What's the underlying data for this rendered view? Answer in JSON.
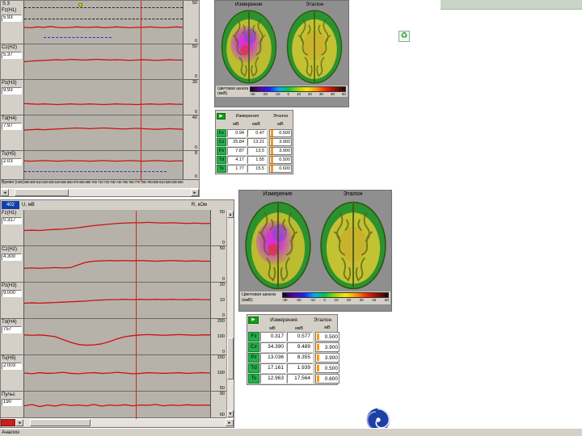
{
  "colors": {
    "panel_bg": "#d4d0c8",
    "plot_bg": "#b6b2aa",
    "trace": "#cc1111",
    "cursor": "#cc2222",
    "table_green": "#22b14c",
    "ref_marker": "#ff9900",
    "header_strip": "#c9d5c7",
    "logo_blue": "#1c3fa8"
  },
  "icons": {
    "recycle": "♻",
    "play": "▶",
    "scroll_left": "◄",
    "scroll_right": "►",
    "scroll_up": "▲",
    "scroll_down": "▼"
  },
  "top_left_chart": {
    "corner_label": "S 3",
    "xlabel": "Время (сек)",
    "x_ticks": [
      "590",
      "600",
      "610",
      "620",
      "630",
      "640",
      "650",
      "660",
      "670",
      "680",
      "690",
      "700",
      "710",
      "720",
      "730",
      "740",
      "750",
      "760",
      "770",
      "780",
      "790",
      "800",
      "810",
      "820",
      "830",
      "840"
    ],
    "cursor_frac": 0.73,
    "channels": [
      {
        "label": "Fz(H1)",
        "value": "5.93",
        "scale": [
          "50",
          "0"
        ],
        "dashes": [
          {
            "y": 0.16,
            "x1": 0,
            "x2": 1,
            "c": "k"
          },
          {
            "y": 0.42,
            "x1": 0,
            "x2": 1,
            "c": "k"
          },
          {
            "y": 0.84,
            "x1": 0.12,
            "x2": 0.55,
            "c": "b"
          }
        ],
        "trace": [
          0.62,
          0.63,
          0.61,
          0.62,
          0.6,
          0.62,
          0.63,
          0.62,
          0.61,
          0.62,
          0.62,
          0.61,
          0.63,
          0.62,
          0.61,
          0.62,
          0.63,
          0.62,
          0.62,
          0.61,
          0.62,
          0.63,
          0.62,
          0.61,
          0.62
        ]
      },
      {
        "label": "Cz(H2)",
        "value": "5.37",
        "scale": [
          "50",
          "0"
        ],
        "trace": [
          0.5,
          0.48,
          0.47,
          0.46,
          0.45,
          0.44,
          0.45,
          0.43,
          0.44,
          0.45,
          0.44,
          0.43,
          0.44,
          0.45,
          0.44,
          0.45,
          0.46,
          0.45,
          0.44,
          0.45,
          0.46,
          0.45,
          0.44,
          0.45,
          0.45
        ]
      },
      {
        "label": "Pz(H3)",
        "value": "9.93",
        "scale": [
          "30",
          "0"
        ],
        "trace": [
          0.68,
          0.69,
          0.7,
          0.69,
          0.7,
          0.71,
          0.7,
          0.69,
          0.7,
          0.7,
          0.69,
          0.7,
          0.71,
          0.7,
          0.69,
          0.7,
          0.7,
          0.71,
          0.7,
          0.69,
          0.7,
          0.7,
          0.69,
          0.7,
          0.7
        ]
      },
      {
        "label": "Td(H4)",
        "value": "7.97",
        "scale": [
          "40",
          "0"
        ],
        "trace": [
          0.42,
          0.41,
          0.4,
          0.41,
          0.4,
          0.39,
          0.38,
          0.37,
          0.36,
          0.37,
          0.38,
          0.37,
          0.36,
          0.37,
          0.38,
          0.39,
          0.38,
          0.37,
          0.38,
          0.39,
          0.4,
          0.39,
          0.38,
          0.39,
          0.4
        ]
      },
      {
        "label": "Ts(H5)",
        "value": "2.03",
        "scale": [
          "8",
          "0"
        ],
        "dashes": [
          {
            "y": 0.72,
            "x1": 0,
            "x2": 0.9,
            "c": "b"
          }
        ],
        "trace": [
          0.35,
          0.36,
          0.35,
          0.34,
          0.35,
          0.36,
          0.35,
          0.34,
          0.35,
          0.35,
          0.36,
          0.35,
          0.34,
          0.35,
          0.36,
          0.35,
          0.34,
          0.35,
          0.36,
          0.35,
          0.34,
          0.35,
          0.36,
          0.35,
          0.35
        ]
      }
    ]
  },
  "bottom_left_chart": {
    "sel_cell": "402",
    "unit_label": "U, мВ",
    "right_label": "R, кОм",
    "analysis_label": "Анализ",
    "cursor_frac": 0.6,
    "channels": [
      {
        "label": "Fz(H1)",
        "value": "0.317",
        "scale": [
          "50",
          "0"
        ],
        "trace": [
          0.58,
          0.57,
          0.58,
          0.56,
          0.55,
          0.54,
          0.52,
          0.5,
          0.47,
          0.44,
          0.42,
          0.4,
          0.38,
          0.37,
          0.36,
          0.36,
          0.35,
          0.36,
          0.37,
          0.36,
          0.37,
          0.38,
          0.37,
          0.38,
          0.38
        ]
      },
      {
        "label": "Cz(H2)",
        "value": "4.300",
        "scale": [
          "50",
          "0"
        ],
        "trace": [
          0.62,
          0.61,
          0.62,
          0.61,
          0.6,
          0.61,
          0.6,
          0.52,
          0.45,
          0.42,
          0.41,
          0.4,
          0.41,
          0.4,
          0.41,
          0.4,
          0.41,
          0.42,
          0.41,
          0.4,
          0.41,
          0.42,
          0.41,
          0.42,
          0.42
        ]
      },
      {
        "label": "Pz(H3)",
        "value": "9.000",
        "scale": [
          "20",
          "10",
          "0"
        ],
        "trace": [
          0.58,
          0.57,
          0.58,
          0.57,
          0.56,
          0.55,
          0.54,
          0.53,
          0.52,
          0.5,
          0.49,
          0.48,
          0.48,
          0.47,
          0.48,
          0.47,
          0.48,
          0.47,
          0.48,
          0.47,
          0.48,
          0.48,
          0.47,
          0.48,
          0.48
        ]
      },
      {
        "label": "Td(H4)",
        "value": "757",
        "scale": [
          "200",
          "100",
          "0"
        ],
        "trace": [
          0.45,
          0.46,
          0.45,
          0.47,
          0.5,
          0.58,
          0.66,
          0.72,
          0.74,
          0.73,
          0.7,
          0.64,
          0.56,
          0.5,
          0.47,
          0.45,
          0.44,
          0.45,
          0.46,
          0.45,
          0.44,
          0.45,
          0.46,
          0.45,
          0.45
        ]
      },
      {
        "label": "Ts(H5)",
        "value": "2.003",
        "scale": [
          "150",
          "100",
          "50"
        ],
        "trace": [
          0.5,
          0.52,
          0.49,
          0.51,
          0.5,
          0.48,
          0.51,
          0.52,
          0.5,
          0.49,
          0.51,
          0.5,
          0.48,
          0.5,
          0.52,
          0.51,
          0.49,
          0.5,
          0.51,
          0.5,
          0.49,
          0.51,
          0.5,
          0.49,
          0.5
        ]
      },
      {
        "label": "Пульс",
        "value": "190",
        "scale": [
          "90",
          "60"
        ],
        "trace": [
          0.55,
          0.5,
          0.58,
          0.52,
          0.56,
          0.5,
          0.54,
          0.52,
          0.55,
          0.5,
          0.56,
          0.52,
          0.54,
          0.51,
          0.55,
          0.52,
          0.53,
          0.5,
          0.55,
          0.52,
          0.54,
          0.51,
          0.53,
          0.52,
          0.53
        ]
      }
    ]
  },
  "brain_top": {
    "title_measure": "Измерение",
    "title_ref": "Эталон",
    "scale_label": "Цветовая шкала (мкВ)",
    "scale_ticks": [
      "-30",
      "-20",
      "-10",
      "0",
      "10",
      "20",
      "30",
      "40",
      "50"
    ]
  },
  "brain_bottom": {
    "title_measure": "Измерение",
    "title_ref": "Эталон",
    "scale_label": "Цветовая шкала (мкВ)",
    "scale_ticks": [
      "-30",
      "-20",
      "-10",
      "0",
      "10",
      "20",
      "30",
      "40",
      "50"
    ]
  },
  "table_top": {
    "header_measure": "Измерения",
    "header_ref": "Эталон",
    "units": [
      "мВ",
      "мкВ",
      "мВ"
    ],
    "rows": [
      {
        "ch": "Fz",
        "v1": "0.94",
        "v2": "0.47",
        "ref": "0.500"
      },
      {
        "ch": "Cz",
        "v1": "25.84",
        "v2": "13.21",
        "ref": "3.900"
      },
      {
        "ch": "Pz",
        "v1": "7.87",
        "v2": "13.5",
        "ref": "3.900"
      },
      {
        "ch": "Td",
        "v1": "4.17",
        "v2": "1.55",
        "ref": "0.500"
      },
      {
        "ch": "Ts",
        "v1": "1.77",
        "v2": "15.5",
        "ref": "0.600"
      }
    ]
  },
  "table_bottom": {
    "header_measure": "Измерения",
    "header_ref": "Эталон",
    "units": [
      "мВ",
      "мкВ",
      "мВ"
    ],
    "rows": [
      {
        "ch": "Fz",
        "v1": "0.317",
        "v2": "0.577",
        "ref": "0.500"
      },
      {
        "ch": "Cz",
        "v1": "34.390",
        "v2": "9.489",
        "ref": "3.900"
      },
      {
        "ch": "Pz",
        "v1": "13.036",
        "v2": "8.355",
        "ref": "3.900"
      },
      {
        "ch": "Td",
        "v1": "17.161",
        "v2": "1.939",
        "ref": "0.500"
      },
      {
        "ch": "Ts",
        "v1": "12.963",
        "v2": "17.564",
        "ref": "0.600"
      }
    ]
  }
}
